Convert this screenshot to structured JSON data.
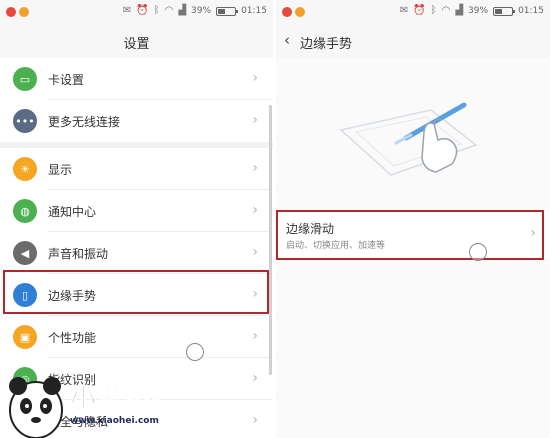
{
  "status_bar": {
    "battery_percent": "39%",
    "battery_level": 0.39,
    "time": "01:15"
  },
  "left_panel": {
    "title": "设置",
    "items": [
      {
        "label": "卡设置",
        "icon": "sim-card-icon",
        "color": "#4caf50"
      },
      {
        "label": "更多无线连接",
        "icon": "more-dots-icon",
        "color": "#5b6b85"
      },
      {
        "label": "显示",
        "icon": "sun-icon",
        "color": "#f5a623"
      },
      {
        "label": "通知中心",
        "icon": "chat-bubble-icon",
        "color": "#4caf50"
      },
      {
        "label": "声音和振动",
        "icon": "speaker-icon",
        "color": "#6b6b6b"
      },
      {
        "label": "边缘手势",
        "icon": "edge-gesture-icon",
        "color": "#2f7fd6"
      },
      {
        "label": "个性功能",
        "icon": "feature-icon",
        "color": "#f5a623"
      },
      {
        "label": "指纹识别",
        "icon": "fingerprint-icon",
        "color": "#4caf50"
      },
      {
        "label": "安全与隐私",
        "icon": "lock-icon",
        "color": "#e0584a"
      }
    ]
  },
  "right_panel": {
    "back_icon": "chevron-left-icon",
    "title": "边缘手势",
    "edge_slide": {
      "title": "边缘滑动",
      "subtitle": "启动、切换应用、加速等"
    }
  },
  "watermark": {
    "logo_text_1": "小",
    "logo_text_2": "黑",
    "logo_text_3": "游戏",
    "url": "www.xiaohei.com"
  },
  "colors": {
    "highlight": "#b0282c",
    "accent_blue": "#2f7fd6"
  }
}
